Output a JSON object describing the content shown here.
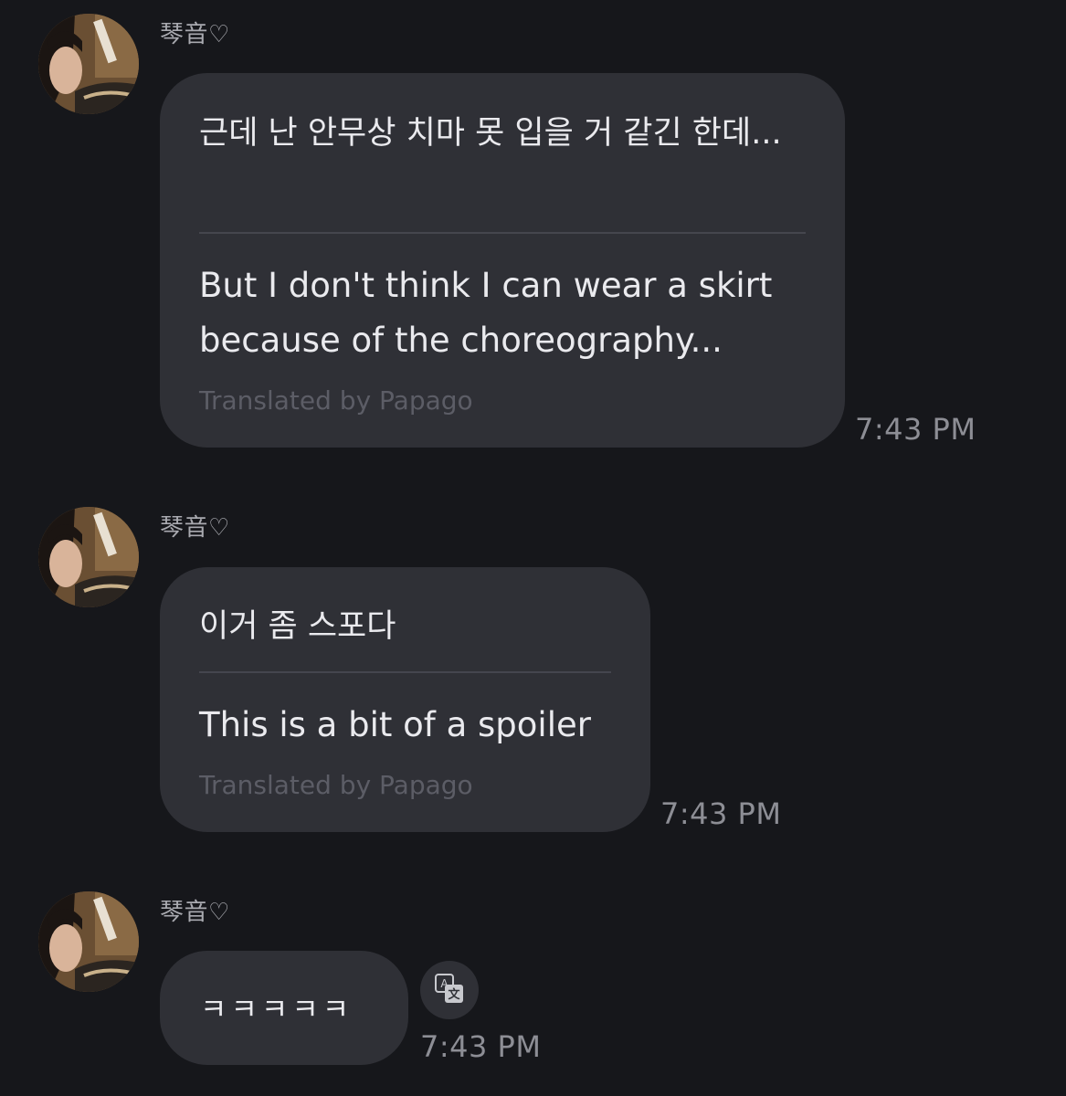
{
  "messages": [
    {
      "sender": "琴音♡",
      "original": "근데 난 안무상 치마 못 입을 거 같긴 한데...",
      "translation": "But I don't think I can wear a skirt because of the choreography...",
      "credit": "Translated by Papago",
      "time": "7:43 PM"
    },
    {
      "sender": "琴音♡",
      "original": "이거 좀 스포다",
      "translation": "This is a bit of a spoiler",
      "credit": "Translated by Papago",
      "time": "7:43 PM"
    },
    {
      "sender": "琴音♡",
      "original": "ㅋㅋㅋㅋㅋ",
      "time": "7:43 PM",
      "action_icon": "translate-icon"
    }
  ],
  "colors": {
    "background": "#16171b",
    "bubble": "#2f3036",
    "text": "#eaeaee",
    "muted": "#8d8e95",
    "credit": "#5c5d66"
  }
}
